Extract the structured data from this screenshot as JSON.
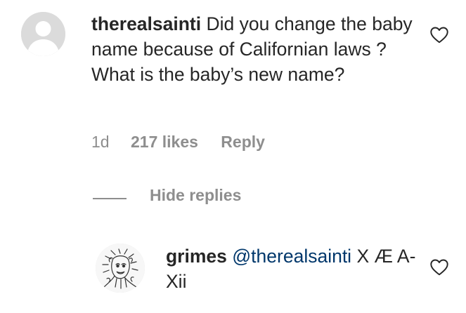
{
  "comment": {
    "username": "therealsainti",
    "text": "Did you change the baby name because of Californian laws ? What is the baby’s new name?",
    "time": "1d",
    "likes": "217 likes",
    "reply_label": "Reply"
  },
  "replies_toggle": {
    "label": "Hide replies"
  },
  "reply": {
    "username": "grimes",
    "mention": "@therealsainti",
    "text": "X Æ A-Xii"
  },
  "icons": {
    "like": "heart-outline-icon",
    "avatar_default": "default-avatar-icon"
  },
  "colors": {
    "text": "#262626",
    "secondary": "#8e8e8e",
    "mention": "#00376b",
    "avatar_placeholder": "#dbdbdb"
  }
}
